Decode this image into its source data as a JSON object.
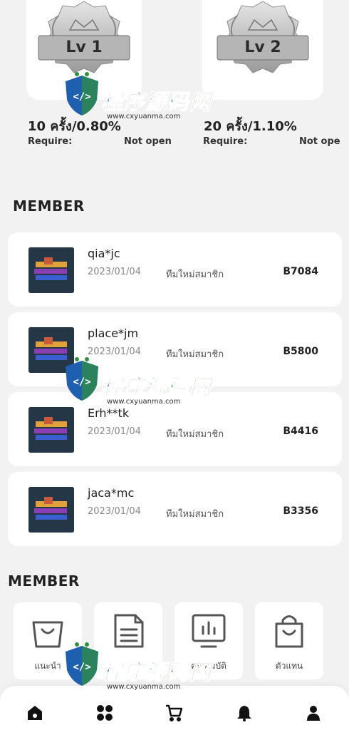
{
  "levels": [
    {
      "badge": "Lv 1",
      "rate": "10 ครั้ง/0.80%",
      "require_label": "Require:",
      "status": "Not open"
    },
    {
      "badge": "Lv 2",
      "rate": "20 ครั้ง/1.10%",
      "require_label": "Require:",
      "status": "Not ope"
    }
  ],
  "members_section": {
    "title": "MEMBER",
    "items": [
      {
        "name": "qia*jc",
        "date": "2023/01/04",
        "status": "ทีมใหม่สมาชิก",
        "code": "B7084"
      },
      {
        "name": "place*jm",
        "date": "2023/01/04",
        "status": "ทีมใหม่สมาชิก",
        "code": "B5800"
      },
      {
        "name": "Erh**tk",
        "date": "2023/01/04",
        "status": "ทีมใหม่สมาชิก",
        "code": "B4416"
      },
      {
        "name": "jaca*mc",
        "date": "2023/01/04",
        "status": "ทีมใหม่สมาชิก",
        "code": "B3356"
      }
    ]
  },
  "functions_section": {
    "title": "MEMBER",
    "tiles": [
      {
        "icon": "shopping-bag-icon",
        "label": "แนะนำ"
      },
      {
        "icon": "document-icon",
        "label": ""
      },
      {
        "icon": "chart-icon",
        "label": "คุณสมบัติ"
      },
      {
        "icon": "bag-icon",
        "label": "ตัวแทน"
      }
    ]
  },
  "bottom_nav": [
    {
      "icon": "home-icon"
    },
    {
      "icon": "grid-icon"
    },
    {
      "icon": "cart-icon"
    },
    {
      "icon": "bell-icon"
    },
    {
      "icon": "user-icon"
    }
  ],
  "watermark": {
    "text_blue": "程序",
    "text_green": "源码网",
    "url": "www.cxyuanma.com"
  },
  "colors": {
    "background": "#f2f2f2",
    "card": "#ffffff",
    "avatar_bg": "#253646",
    "watermark_blue": "#1f5fb0",
    "watermark_green": "#2f8f3f"
  }
}
